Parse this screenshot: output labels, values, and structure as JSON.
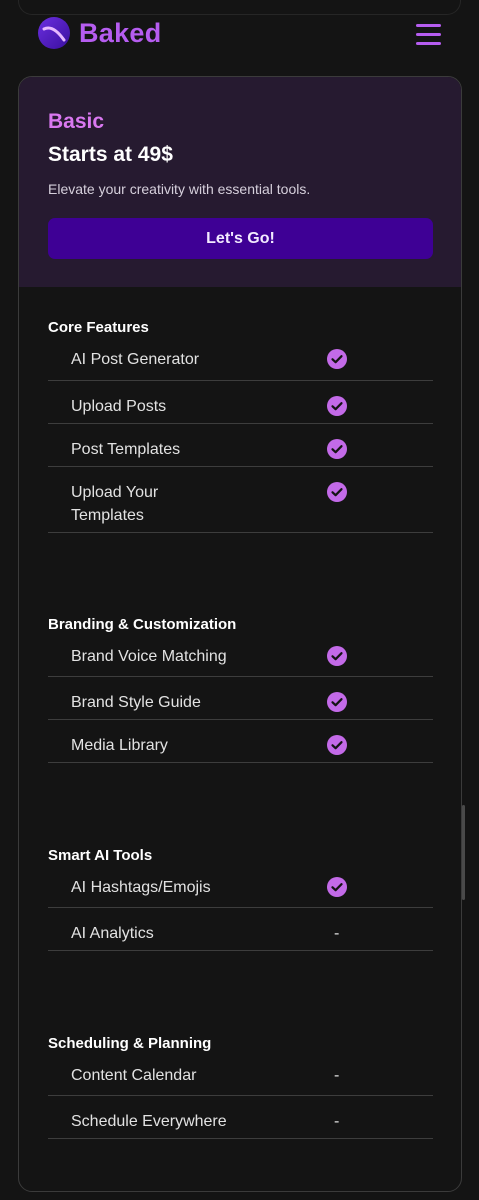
{
  "brand": {
    "name": "Baked",
    "accent": "#b65df0"
  },
  "plan": {
    "name": "Basic",
    "price": "Starts at 49$",
    "description": "Elevate your creativity with essential tools.",
    "cta_label": "Let's Go!"
  },
  "sections": [
    {
      "title": "Core Features",
      "features": [
        {
          "label": "AI Post Generator",
          "status": "check"
        },
        {
          "label": "Upload Posts",
          "status": "check"
        },
        {
          "label": "Post Templates",
          "status": "check"
        },
        {
          "label": "Upload Your\nTemplates",
          "status": "check"
        }
      ]
    },
    {
      "title": "Branding & Customization",
      "features": [
        {
          "label": "Brand Voice Matching",
          "status": "check"
        },
        {
          "label": "Brand Style Guide",
          "status": "check"
        },
        {
          "label": "Media Library",
          "status": "check"
        }
      ]
    },
    {
      "title": "Smart AI Tools",
      "features": [
        {
          "label": "AI Hashtags/Emojis",
          "status": "check"
        },
        {
          "label": "AI Analytics",
          "status": "dash",
          "value": "-"
        }
      ]
    },
    {
      "title": "Scheduling & Planning",
      "features": [
        {
          "label": "Content Calendar",
          "status": "dash",
          "value": "-"
        },
        {
          "label": "Schedule Everywhere",
          "status": "dash",
          "value": "-"
        }
      ]
    }
  ]
}
